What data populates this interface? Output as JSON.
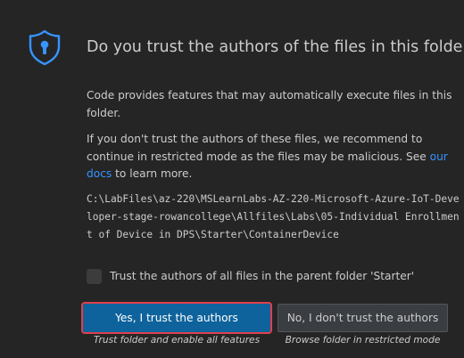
{
  "dialog": {
    "title": "Do you trust the authors of the files in this folder?",
    "paragraph1": "Code provides features that may automatically execute files in this folder.",
    "paragraph2_before_link": "If you don't trust the authors of these files, we recommend to continue in restricted mode as the files may be malicious. See ",
    "paragraph2_link": "our docs",
    "paragraph2_after_link": " to learn more.",
    "folder_path": "C:\\LabFiles\\az-220\\MSLearnLabs-AZ-220-Microsoft-Azure-IoT-Developer-stage-rowancollege\\Allfiles\\Labs\\05-Individual Enrollment of Device in DPS\\Starter\\ContainerDevice",
    "parent_checkbox_label": "Trust the authors of all files in the parent folder 'Starter'",
    "trust_button_label": "Yes, I trust the authors",
    "trust_button_hint": "Trust folder and enable all features",
    "distrust_button_label": "No, I don't trust the authors",
    "distrust_button_hint": "Browse folder in restricted mode",
    "icon": "shield-keyhole-icon"
  },
  "colors": {
    "background": "#252526",
    "text": "#cccccc",
    "link": "#3794ff",
    "primary_button": "#0e639c",
    "secondary_button": "#3a3d41",
    "shield_icon": "#3794ff",
    "highlight_outline": "#e0404c"
  }
}
